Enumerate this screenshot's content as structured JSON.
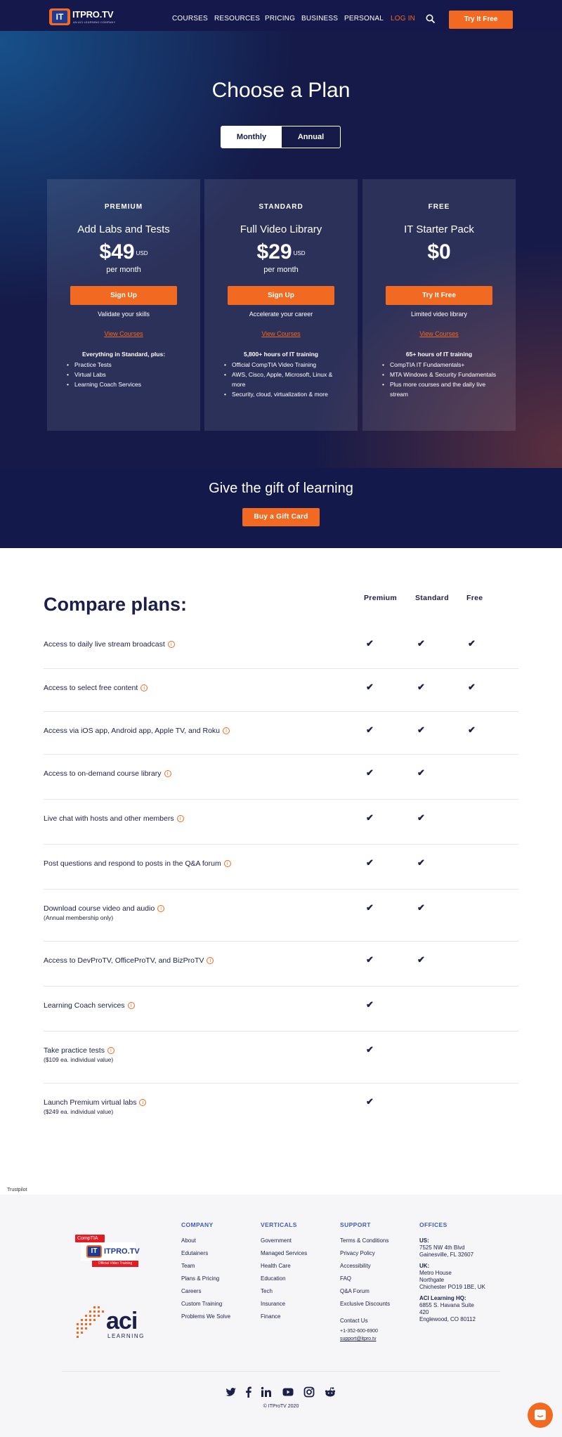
{
  "nav": {
    "logo_text": "ITPRO.TV",
    "logo_sub": "AN ACI LEARNING COMPANY",
    "links": [
      "COURSES",
      "RESOURCES",
      "PRICING",
      "BUSINESS",
      "PERSONAL"
    ],
    "login": "LOG IN",
    "cta": "Try It Free"
  },
  "hero": {
    "title": "Choose a Plan",
    "billing_toggle": {
      "monthly": "Monthly",
      "annual": "Annual",
      "selected": "Monthly"
    }
  },
  "plans": [
    {
      "tier": "PREMIUM",
      "name": "Add Labs and Tests",
      "price": "$49",
      "currency": "USD",
      "period": "per month",
      "button": "Sign Up",
      "tagline": "Validate your skills",
      "link": "View Courses",
      "features_heading": "Everything in Standard, plus:",
      "features": [
        "Practice Tests",
        "Virtual Labs",
        "Learning Coach Services"
      ]
    },
    {
      "tier": "STANDARD",
      "name": "Full Video Library",
      "price": "$29",
      "currency": "USD",
      "period": "per month",
      "button": "Sign Up",
      "tagline": "Accelerate your career",
      "link": "View Courses",
      "features_heading": "5,800+ hours of IT training",
      "features": [
        "Official CompTIA Video Training",
        "AWS, Cisco, Apple, Microsoft, Linux & more",
        "Security, cloud, virtualization & more"
      ]
    },
    {
      "tier": "FREE",
      "name": "IT Starter Pack",
      "price": "$0",
      "currency": "",
      "period": "",
      "button": "Try It Free",
      "tagline": "Limited video library",
      "link": "View Courses",
      "features_heading": "65+ hours of IT training",
      "features": [
        "CompTIA IT Fundamentals+",
        "MTA Windows & Security Fundamentals",
        "Plus more courses and the daily live stream"
      ]
    }
  ],
  "gift": {
    "title": "Give the gift of learning",
    "button": "Buy a Gift Card"
  },
  "compare": {
    "title": "Compare plans:",
    "columns": [
      "Premium",
      "Standard",
      "Free"
    ],
    "info_glyph": "i",
    "check_glyph": "✔",
    "rows": [
      {
        "label": "Access to daily live stream broadcast",
        "note": "",
        "premium": true,
        "standard": true,
        "free": true
      },
      {
        "label": "Access to select free content",
        "note": "",
        "premium": true,
        "standard": true,
        "free": true
      },
      {
        "label": "Access via iOS app, Android app, Apple TV, and Roku",
        "note": "",
        "premium": true,
        "standard": true,
        "free": true
      },
      {
        "label": "Access to on-demand course library",
        "note": "",
        "premium": true,
        "standard": true,
        "free": false
      },
      {
        "label": "Live chat with hosts and other members",
        "note": "",
        "premium": true,
        "standard": true,
        "free": false
      },
      {
        "label": "Post questions and respond to posts in the Q&A forum",
        "note": "",
        "premium": true,
        "standard": true,
        "free": false
      },
      {
        "label": "Download course video and audio",
        "note": "(Annual membership only)",
        "premium": true,
        "standard": true,
        "free": false
      },
      {
        "label": "Access to DevProTV, OfficeProTV, and BizProTV",
        "note": "",
        "premium": true,
        "standard": true,
        "free": false
      },
      {
        "label": "Learning Coach services",
        "note": "",
        "premium": true,
        "standard": false,
        "free": false
      },
      {
        "label": "Take practice tests",
        "note": "($109 ea. individual value)",
        "premium": true,
        "standard": false,
        "free": false
      },
      {
        "label": "Launch Premium virtual labs",
        "note": "($249 ea. individual value)",
        "premium": true,
        "standard": false,
        "free": false
      }
    ]
  },
  "trustpilot": "Trustpilot",
  "footer": {
    "badge": {
      "top": "CompTIA",
      "word": "ITPRO.TV",
      "strip": "Official Video Training"
    },
    "aci": {
      "word": "aci",
      "sub": "LEARNING"
    },
    "columns": [
      {
        "heading": "COMPANY",
        "items": [
          "About",
          "Edutainers",
          "Team",
          "Plans & Pricing",
          "Careers",
          "Custom Training",
          "Problems We Solve"
        ]
      },
      {
        "heading": "VERTICALS",
        "items": [
          "Government",
          "Managed Services",
          "Health Care",
          "Education",
          "Tech",
          "Insurance",
          "Finance"
        ]
      },
      {
        "heading": "SUPPORT",
        "items": [
          "Terms & Conditions",
          "Privacy Policy",
          "Accessibility",
          "FAQ",
          "Q&A Forum",
          "Exclusive Discounts"
        ]
      }
    ],
    "contact": {
      "heading": "Contact Us",
      "phone": "+1-352-600-6900",
      "email": "support@itpro.tv"
    },
    "offices": {
      "heading": "OFFICES",
      "us": {
        "label": "US:",
        "lines": [
          "7525 NW 4th Blvd",
          "Gainesville, FL 32607"
        ]
      },
      "uk": {
        "label": "UK:",
        "lines": [
          "Metro House",
          "Northgate",
          "Chichester PO19 1BE, UK"
        ]
      },
      "hq": {
        "label": "ACI Learning HQ:",
        "lines": [
          "6855 S. Havana Suite",
          "420",
          "Englewood, CO 80112"
        ]
      }
    },
    "social_icons": [
      "twitter-icon",
      "facebook-icon",
      "linkedin-icon",
      "youtube-icon",
      "instagram-icon",
      "reddit-icon"
    ],
    "copyright": "© ITProTV 2020"
  },
  "colors": {
    "navy": "#151a48",
    "orange": "#f26a21",
    "text": "#1c1f4a",
    "footer_bg": "#f6f6f8"
  }
}
